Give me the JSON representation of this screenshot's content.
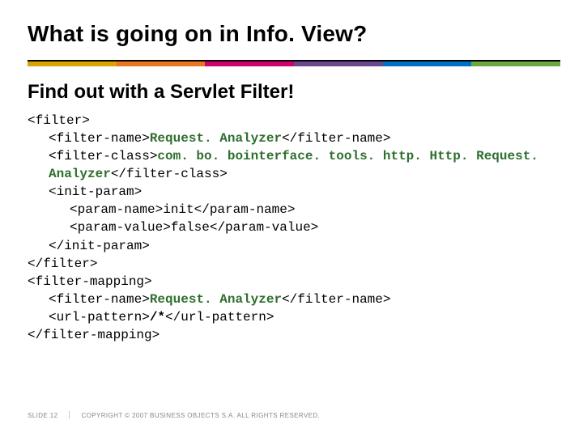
{
  "title": "What is going on in Info. View?",
  "subtitle": "Find out with a Servlet Filter!",
  "code": {
    "filter_open": "<filter>",
    "filter_name_open": "<filter-name>",
    "filter_name_val": "Request. Analyzer",
    "filter_name_close": "</filter-name>",
    "filter_class_open": "<filter-class>",
    "filter_class_val": "com. bo. bointerface. tools. http. Http. Request. Analyzer",
    "filter_class_close": "</filter-class>",
    "init_param_open": "<init-param>",
    "param_name_open": "<param-name>",
    "param_name_val": "init",
    "param_name_close": "</param-name>",
    "param_value_open": "<param-value>",
    "param_value_val": "false",
    "param_value_close": "</param-value>",
    "init_param_close": "</init-param>",
    "filter_close": "</filter>",
    "filter_mapping_open": "<filter-mapping>",
    "url_pattern_open": "<url-pattern>",
    "url_pattern_val": "/*",
    "url_pattern_close": "</url-pattern>",
    "filter_mapping_close": "</filter-mapping>"
  },
  "footer": {
    "slide": "SLIDE 12",
    "copyright": "COPYRIGHT © 2007 BUSINESS OBJECTS S.A.  ALL RIGHTS RESERVED."
  }
}
